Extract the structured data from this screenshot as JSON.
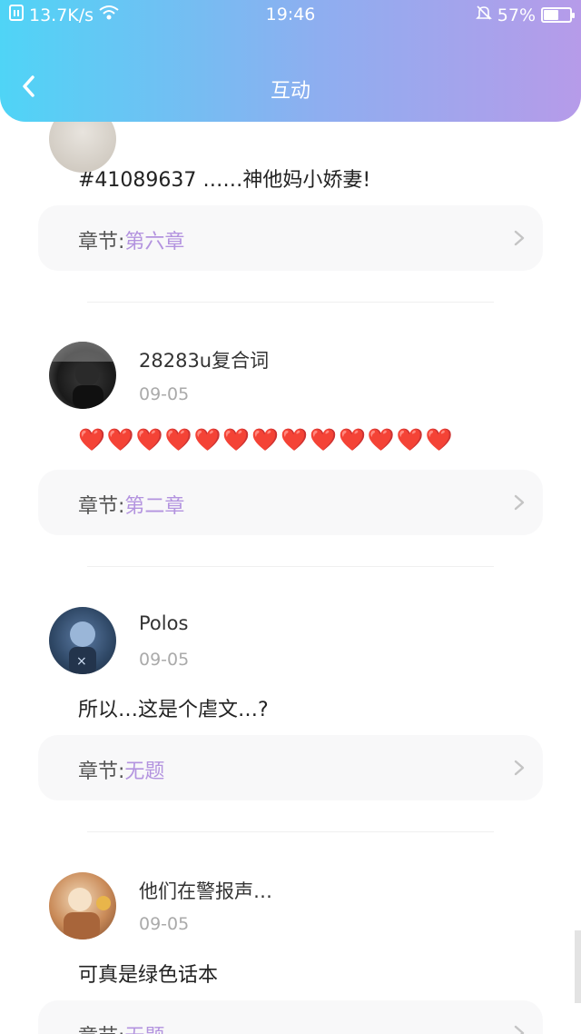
{
  "status_bar": {
    "network_speed": "13.7K/s",
    "time": "19:46",
    "battery_percent": "57%",
    "battery_level": 0.57
  },
  "header": {
    "title": "互动"
  },
  "comments": [
    {
      "text": "#41089637 ……神他妈小娇妻!",
      "chapter_label": "章节:",
      "chapter_value": "第六章"
    },
    {
      "username": "28283u复合词",
      "date": "09-05",
      "text": "❤️❤️❤️❤️❤️❤️❤️❤️❤️❤️❤️❤️❤️",
      "chapter_label": "章节:",
      "chapter_value": "第二章"
    },
    {
      "username": "Polos",
      "date": "09-05",
      "text": "所以…这是个虐文…?",
      "chapter_label": "章节:",
      "chapter_value": "无题"
    },
    {
      "username": "他们在警报声…",
      "date": "09-05",
      "text": "可真是绿色话本",
      "chapter_label": "章节:",
      "chapter_value": "无题"
    }
  ],
  "colors": {
    "header_gradient_start": "#4fd4f6",
    "header_gradient_end": "#b69be9",
    "chapter_accent": "#b393df"
  }
}
